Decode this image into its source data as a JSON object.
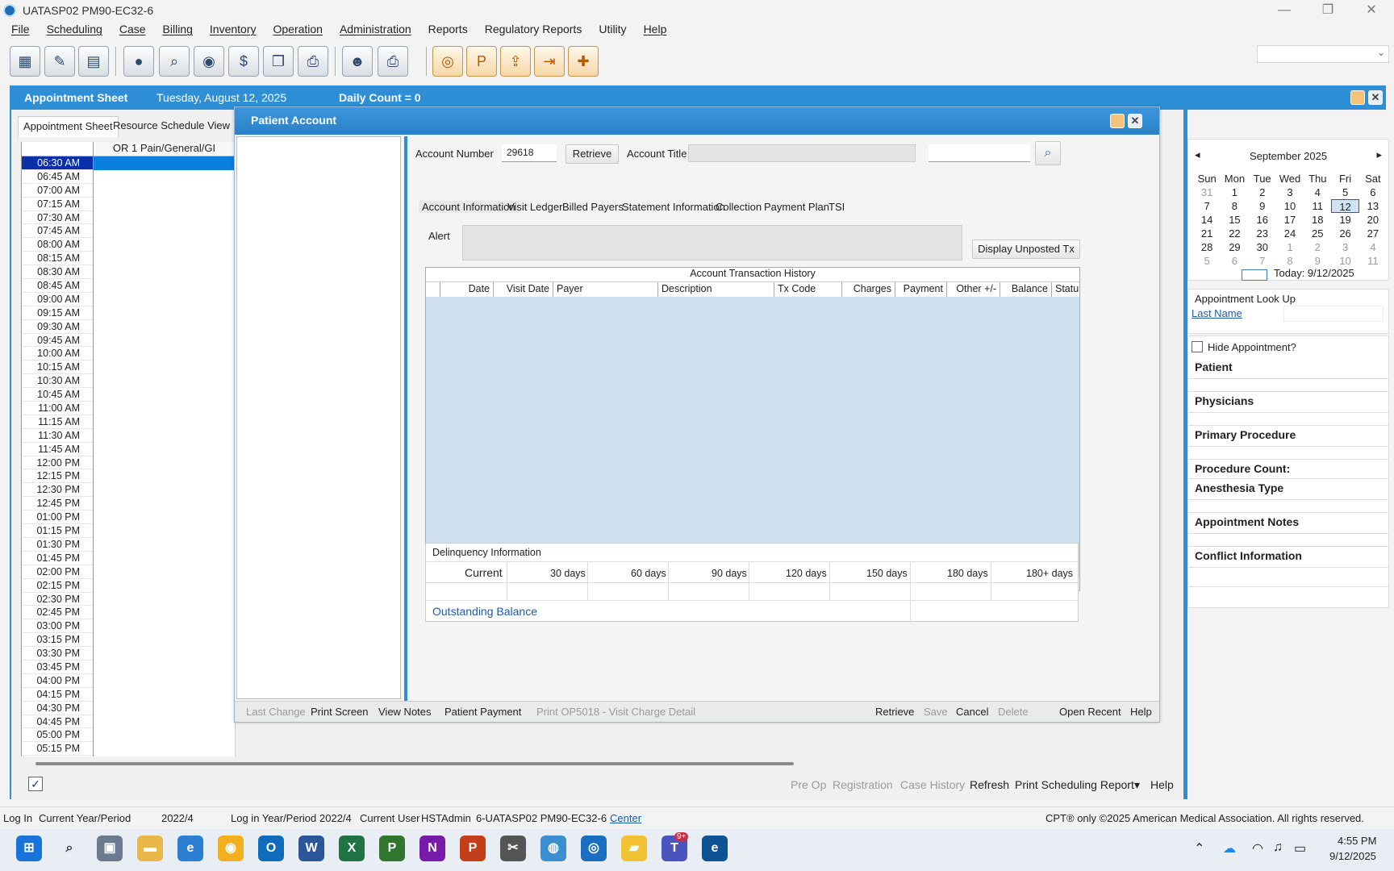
{
  "window": {
    "title": "UATASP02 PM90-EC32-6",
    "min": "—",
    "max": "❐",
    "close": "✕"
  },
  "menu": [
    "File",
    "Scheduling",
    "Case",
    "Billing",
    "Inventory",
    "Operation",
    "Administration",
    "Reports",
    "Regulatory Reports",
    "Utility",
    "Help"
  ],
  "toolbar_icons": [
    "calendar-grid-icon",
    "edit-form-icon",
    "briefcase-icon",
    "patient-icon",
    "search-icon",
    "ledger-icon",
    "dollar-icon",
    "payment-icon",
    "printer-icon",
    "user-lookup-icon",
    "print-dropdown-icon",
    "report-icon",
    "report-p-icon",
    "upload-icon",
    "export-icon",
    "add-icon"
  ],
  "schedule": {
    "header_title": "Appointment Sheet",
    "date": "Tuesday, August 12, 2025",
    "daily_count": "Daily Count = 0",
    "tabs": [
      "Appointment Sheet",
      "Resource Schedule View"
    ],
    "column_header": "OR 1 Pain/General/GI",
    "times": [
      "06:30 AM",
      "06:45 AM",
      "07:00 AM",
      "07:15 AM",
      "07:30 AM",
      "07:45 AM",
      "08:00 AM",
      "08:15 AM",
      "08:30 AM",
      "08:45 AM",
      "09:00 AM",
      "09:15 AM",
      "09:30 AM",
      "09:45 AM",
      "10:00 AM",
      "10:15 AM",
      "10:30 AM",
      "10:45 AM",
      "11:00 AM",
      "11:15 AM",
      "11:30 AM",
      "11:45 AM",
      "12:00 PM",
      "12:15 PM",
      "12:30 PM",
      "12:45 PM",
      "01:00 PM",
      "01:15 PM",
      "01:30 PM",
      "01:45 PM",
      "02:00 PM",
      "02:15 PM",
      "02:30 PM",
      "02:45 PM",
      "03:00 PM",
      "03:15 PM",
      "03:30 PM",
      "03:45 PM",
      "04:00 PM",
      "04:15 PM",
      "04:30 PM",
      "04:45 PM",
      "05:00 PM",
      "05:15 PM"
    ],
    "bottom_actions": {
      "pre_op": "Pre Op",
      "registration": "Registration",
      "case_history": "Case History",
      "refresh": "Refresh",
      "print_report": "Print Scheduling Report",
      "dropdown": "▾",
      "help": "Help"
    }
  },
  "calendar": {
    "month": "September 2025",
    "days": [
      "Sun",
      "Mon",
      "Tue",
      "Wed",
      "Thu",
      "Fri",
      "Sat"
    ],
    "dates": [
      "31",
      "1",
      "2",
      "3",
      "4",
      "5",
      "6",
      "7",
      "8",
      "9",
      "10",
      "11",
      "12",
      "13",
      "14",
      "15",
      "16",
      "17",
      "18",
      "19",
      "20",
      "21",
      "22",
      "23",
      "24",
      "25",
      "26",
      "27",
      "28",
      "29",
      "30",
      "1",
      "2",
      "3",
      "4",
      "5",
      "6",
      "7",
      "8",
      "9",
      "10",
      "11"
    ],
    "today_label": "Today: 9/12/2025",
    "prev": "◂",
    "next": "▸"
  },
  "lookup": {
    "title": "Appointment Look Up",
    "last_name_link": "Last Name"
  },
  "sidepanel": {
    "hide_label": "Hide Appointment?",
    "sections": [
      "Patient",
      "Physicians",
      "Primary Procedure",
      "Procedure Count:",
      "Anesthesia Type",
      "Appointment Notes",
      "Conflict Information"
    ]
  },
  "dialog": {
    "title": "Patient Account",
    "account_number_label": "Account Number",
    "account_number_value": "29618",
    "retrieve_button": "Retrieve",
    "account_title_label": "Account Title",
    "tabs": [
      "Account Information",
      "Visit Ledger",
      "Billed Payers",
      "Statement Information",
      "Collection",
      "Payment Plan",
      "TSI"
    ],
    "alert_label": "Alert",
    "display_unposted": "Display Unposted Tx",
    "history_title": "Account Transaction History",
    "columns": [
      "Date",
      "Visit Date",
      "Payer",
      "Description",
      "Tx Code",
      "Charges",
      "Payment",
      "Other +/-",
      "Balance",
      "Statu"
    ],
    "delinquency_title": "Delinquency Information",
    "delinquency_cols": [
      "Current",
      "30 days",
      "60 days",
      "90 days",
      "120 days",
      "150 days",
      "180 days",
      "180+ days"
    ],
    "outstanding_balance": "Outstanding Balance",
    "footer_left": [
      "Last Change",
      "Print Screen",
      "View Notes",
      "Patient Payment",
      "Print OP5018 - Visit Charge Detail"
    ],
    "footer_right": [
      "Retrieve",
      "Save",
      "Cancel",
      "Delete",
      "Open Recent",
      "Help"
    ]
  },
  "statusbar": {
    "log_in": "Log In",
    "current_year_label": "Current Year/Period",
    "current_year_value": "2022/4",
    "login_year_label": "Log in Year/Period",
    "login_year_value": "2022/4",
    "current_user_label": "Current User",
    "current_user_value": "HSTAdmin",
    "server": "6-UATASP02 PM90-EC32-6",
    "center_link": "Center",
    "copyright": "CPT® only ©2025 American Medical Association.  All rights reserved."
  },
  "taskbar": {
    "time": "4:55 PM",
    "date": "9/12/2025",
    "teams_badge": "9+"
  }
}
